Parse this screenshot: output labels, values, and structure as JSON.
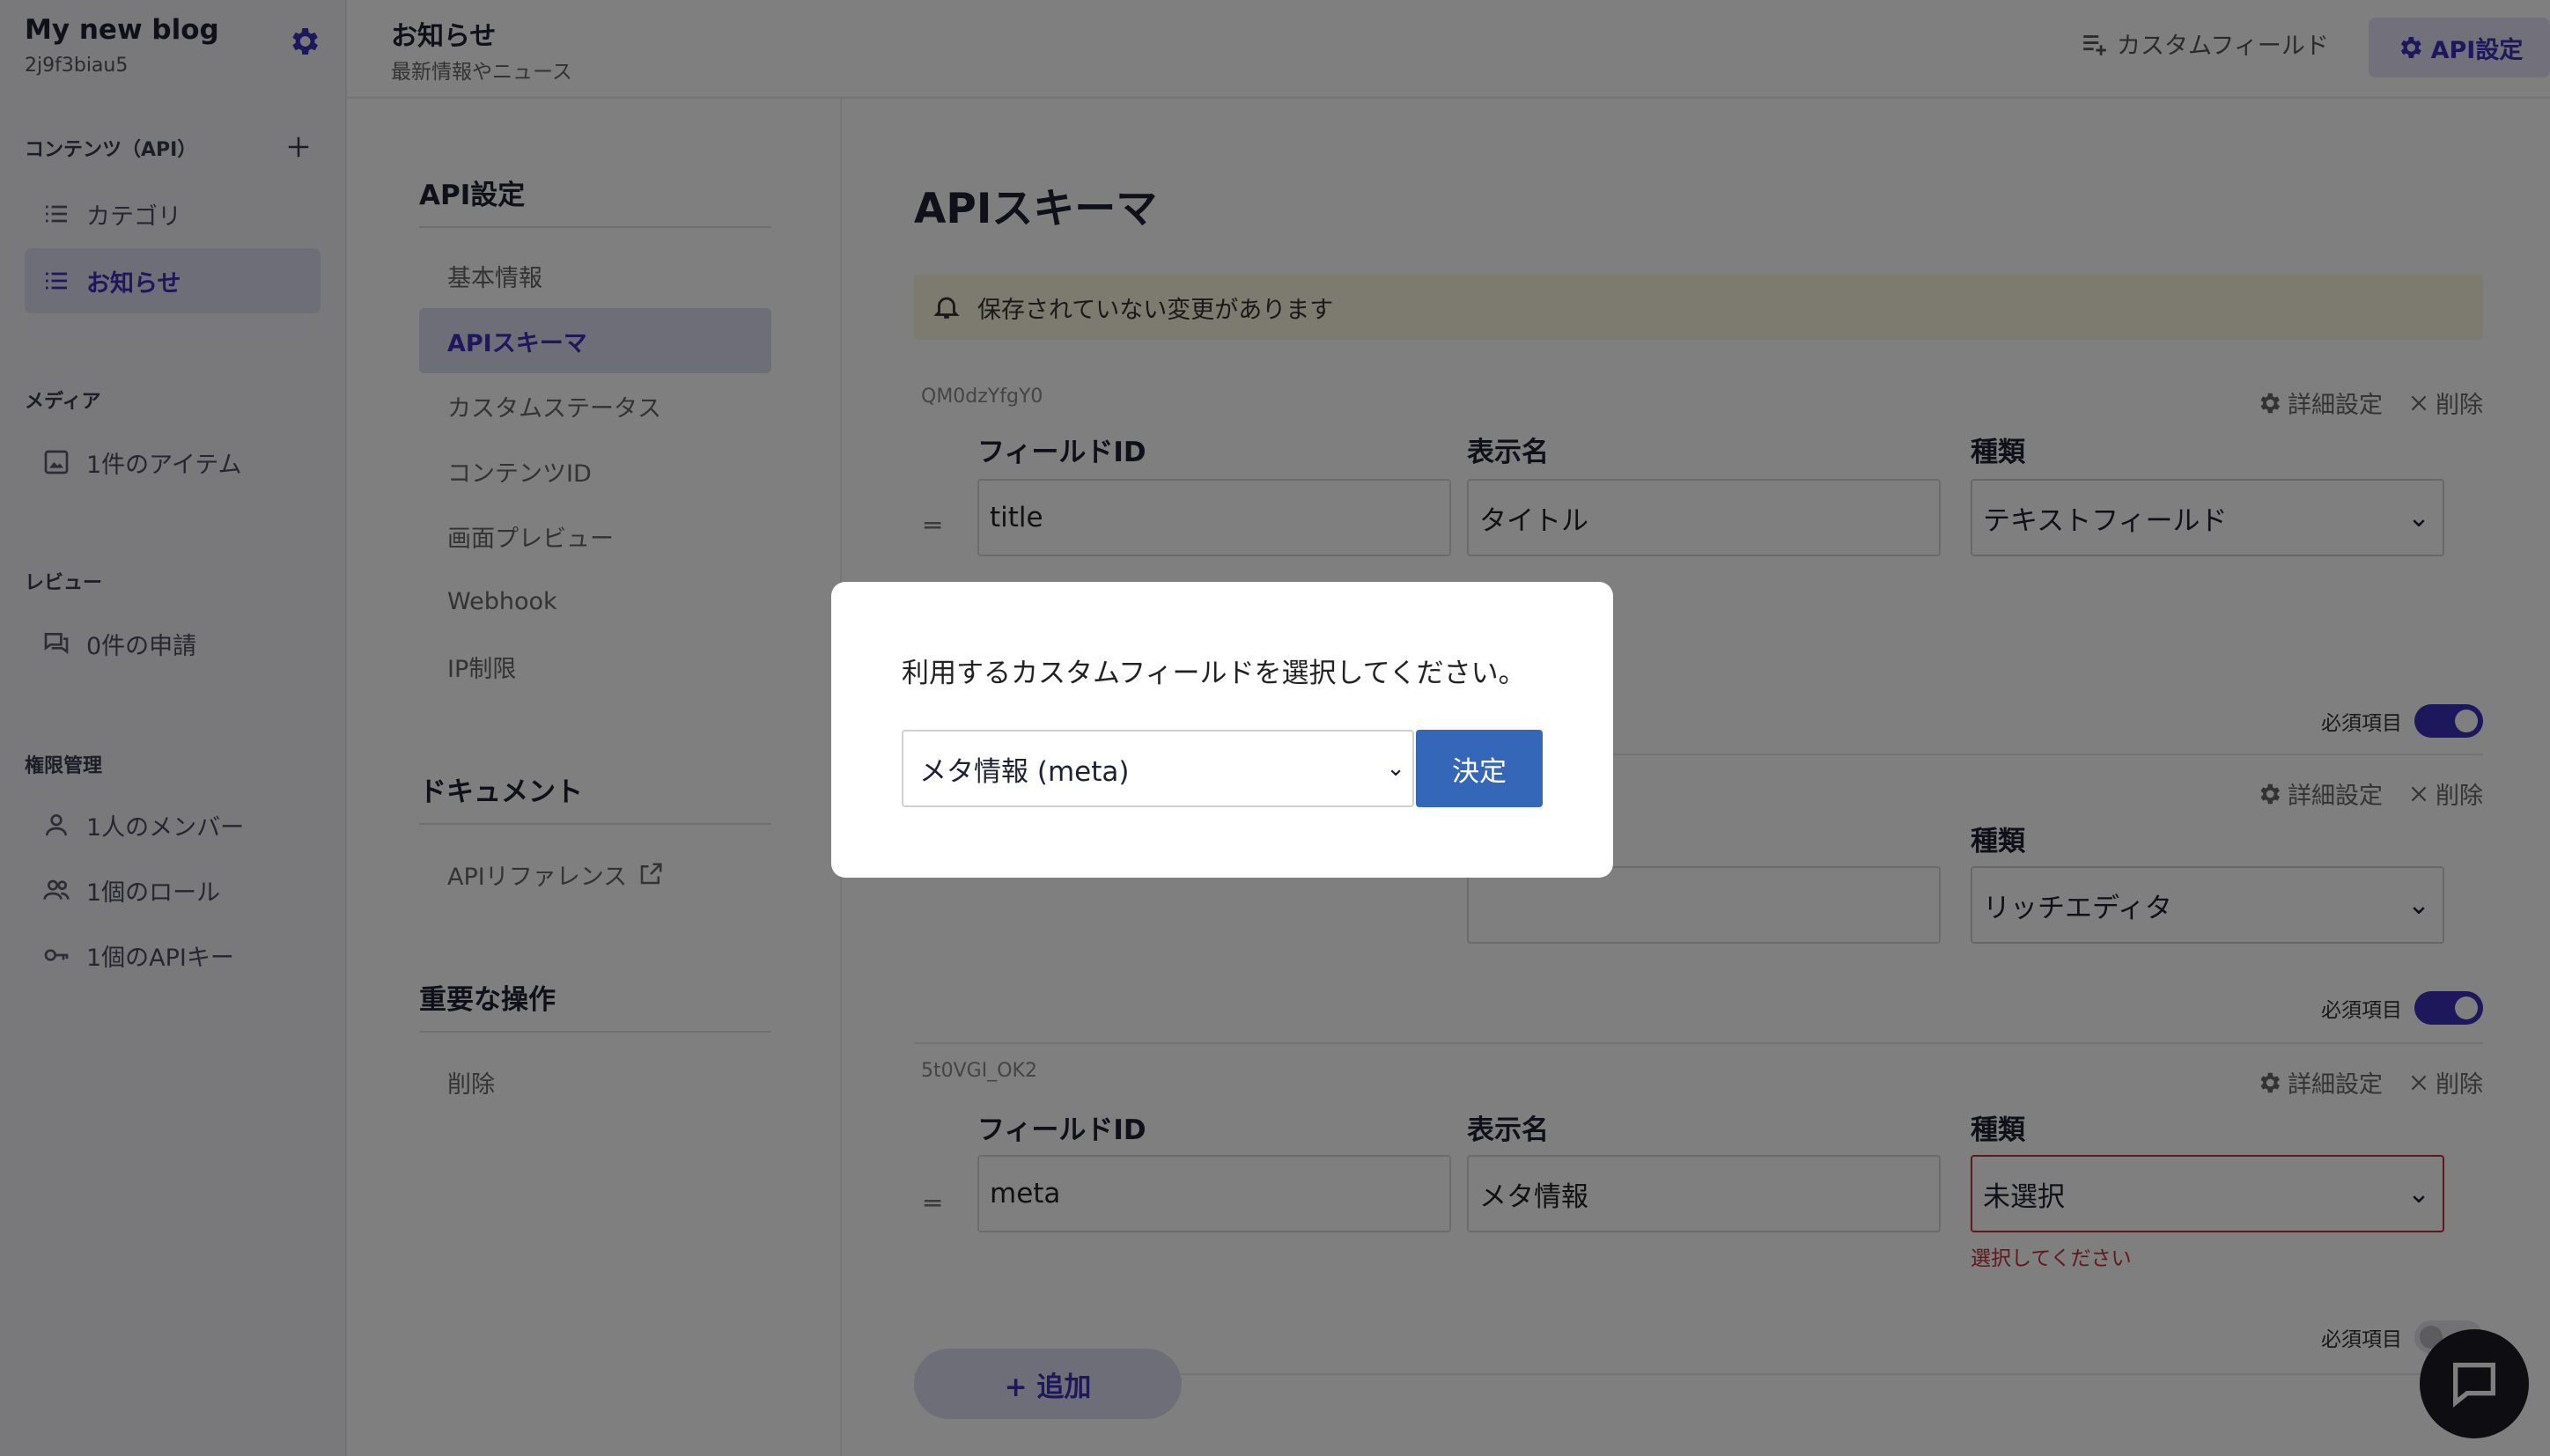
{
  "sidebar": {
    "project_name": "My new blog",
    "project_id": "2j9f3biau5",
    "contents_section": "コンテンツ（API）",
    "contents_items": [
      {
        "label": "カテゴリ"
      },
      {
        "label": "お知らせ"
      }
    ],
    "media_section": "メディア",
    "media_item": "1件のアイテム",
    "review_section": "レビュー",
    "review_item": "0件の申請",
    "auth_section": "権限管理",
    "auth_items": [
      {
        "label": "1人のメンバー"
      },
      {
        "label": "1個のロール"
      },
      {
        "label": "1個のAPIキー"
      }
    ]
  },
  "header": {
    "title": "お知らせ",
    "subtitle": "最新情報やニュース",
    "custom_field_label": "カスタムフィールド",
    "api_settings_label": "API設定"
  },
  "settings_nav": {
    "api_section": "API設定",
    "api_items": [
      {
        "label": "基本情報"
      },
      {
        "label": "APIスキーマ"
      },
      {
        "label": "カスタムステータス"
      },
      {
        "label": "コンテンツID"
      },
      {
        "label": "画面プレビュー"
      },
      {
        "label": "Webhook"
      },
      {
        "label": "IP制限"
      }
    ],
    "doc_section": "ドキュメント",
    "doc_item": "APIリファレンス",
    "danger_section": "重要な操作",
    "danger_item": "削除"
  },
  "main": {
    "title": "APIスキーマ",
    "warning": "保存されていない変更があります",
    "detail_label": "詳細設定",
    "delete_label": "削除",
    "required_label": "必須項目",
    "field_id_label": "フィールドID",
    "display_name_label": "表示名",
    "type_label": "種類",
    "fields": [
      {
        "key": "QM0dzYfgY0",
        "field_id": "title",
        "display_name": "タイトル",
        "type": "テキストフィールド",
        "required": true
      },
      {
        "key": "",
        "field_id": "",
        "display_name": "",
        "type": "リッチエディタ",
        "required": true
      },
      {
        "key": "5t0VGI_OK2",
        "field_id": "meta",
        "display_name": "メタ情報",
        "type": "未選択",
        "required": false,
        "error": "選択してください"
      }
    ],
    "add_button": "+ 追加"
  },
  "modal": {
    "message": "利用するカスタムフィールドを選択してください。",
    "selected_option": "メタ情報 (meta)",
    "confirm_button": "決定"
  },
  "colors": {
    "accent": "#3a2fb8",
    "confirm": "#3567b8",
    "error": "#c0313c"
  }
}
